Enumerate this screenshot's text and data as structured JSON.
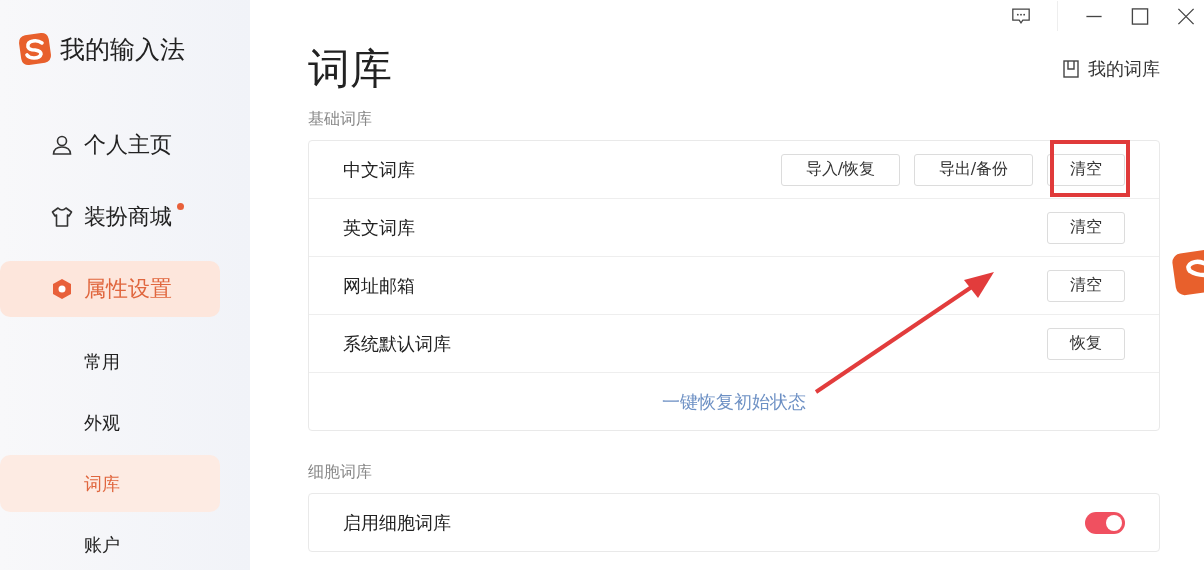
{
  "app": {
    "title": "我的输入法"
  },
  "nav": [
    {
      "label": "个人主页",
      "selected": false
    },
    {
      "label": "装扮商城",
      "badge": true,
      "selected": false
    },
    {
      "label": "属性设置",
      "selected": true,
      "children": [
        {
          "label": "常用",
          "selected": false
        },
        {
          "label": "外观",
          "selected": false
        },
        {
          "label": "词库",
          "selected": true
        },
        {
          "label": "账户",
          "selected": false
        }
      ]
    }
  ],
  "page": {
    "title": "词库",
    "link": "我的词库"
  },
  "sections": [
    {
      "title": "基础词库",
      "rows": [
        {
          "kind": "buttons",
          "label": "中文词库",
          "buttons": [
            {
              "label": "导入/恢复",
              "highlighted": false
            },
            {
              "label": "导出/备份",
              "highlighted": false
            },
            {
              "label": "清空",
              "highlighted": true
            }
          ]
        },
        {
          "kind": "buttons",
          "label": "英文词库",
          "buttons": [
            {
              "label": "清空",
              "highlighted": false
            }
          ]
        },
        {
          "kind": "buttons",
          "label": "网址邮箱",
          "buttons": [
            {
              "label": "清空",
              "highlighted": false
            }
          ]
        },
        {
          "kind": "buttons",
          "label": "系统默认词库",
          "buttons": [
            {
              "label": "恢复",
              "highlighted": false
            }
          ]
        },
        {
          "kind": "link",
          "label": "一键恢复初始状态"
        }
      ]
    },
    {
      "title": "细胞词库",
      "rows": [
        {
          "kind": "toggle",
          "label": "启用细胞词库",
          "on": true
        }
      ]
    }
  ]
}
